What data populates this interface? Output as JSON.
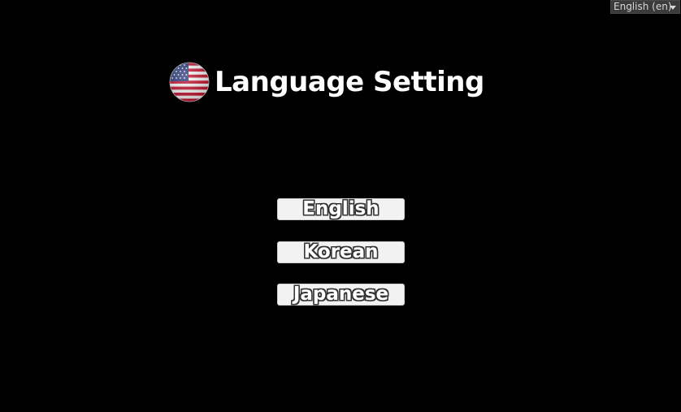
{
  "locale_dropdown": {
    "selected": "English (en)"
  },
  "header": {
    "icon": "us-flag-icon",
    "title": "Language Setting"
  },
  "buttons": [
    {
      "label": "English"
    },
    {
      "label": "Korean"
    },
    {
      "label": "Japanese"
    }
  ],
  "colors": {
    "background": "#000000",
    "button_fill": "#f2f2f2",
    "text": "#ffffff",
    "flag_red": "#c8102e",
    "flag_blue": "#2a3a7a"
  }
}
